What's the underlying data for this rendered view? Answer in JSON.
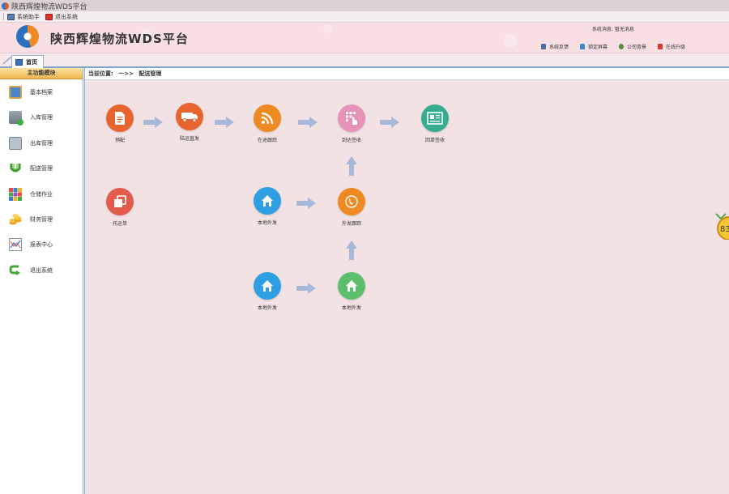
{
  "window": {
    "title": "陕西辉煌物流WDS平台"
  },
  "menubar": {
    "items": [
      {
        "label": "系统助手",
        "icon": "helper-icon"
      },
      {
        "label": "退出系统",
        "icon": "exit-icon"
      }
    ]
  },
  "header": {
    "brand_prefix": "陕西辉煌物流",
    "brand_wds": "WDS",
    "brand_suffix": "平台",
    "system_message": "系统消息: 暂无消息",
    "actions": [
      {
        "label": "系统反馈",
        "icon": "feedback-icon"
      },
      {
        "label": "锁定屏幕",
        "icon": "lock-icon"
      },
      {
        "label": "公司背景",
        "icon": "background-icon"
      },
      {
        "label": "在线升级",
        "icon": "upgrade-icon"
      }
    ]
  },
  "tabs": [
    {
      "label": "首页"
    }
  ],
  "sidebar": {
    "title": "主功能模块",
    "items": [
      {
        "label": "基本档案",
        "icon": "archive-icon"
      },
      {
        "label": "入库管理",
        "icon": "inbound-icon"
      },
      {
        "label": "出库管理",
        "icon": "outbound-icon"
      },
      {
        "label": "配送管理",
        "icon": "delivery-icon"
      },
      {
        "label": "仓储作业",
        "icon": "warehouse-icon"
      },
      {
        "label": "财务管理",
        "icon": "finance-icon"
      },
      {
        "label": "报表中心",
        "icon": "report-icon"
      },
      {
        "label": "退出系统",
        "icon": "logout-icon"
      }
    ]
  },
  "breadcrumb": {
    "prefix": "当前位置:",
    "arrow": "一>>",
    "current": "配送管理"
  },
  "flow": {
    "nodes": [
      {
        "label": "预配",
        "color": "#e8642f",
        "icon": "document-icon"
      },
      {
        "label": "陆运直发",
        "color": "#e8642f",
        "icon": "truck-icon"
      },
      {
        "label": "在途跟踪",
        "color": "#ef8a22",
        "icon": "rss-icon"
      },
      {
        "label": "到达签收",
        "color": "#e693b8",
        "icon": "touch-keypad-icon"
      },
      {
        "label": "回单签收",
        "color": "#35ad8e",
        "icon": "receipt-icon"
      },
      {
        "label": "托运单",
        "color": "#e35b4c",
        "icon": "copy-icon"
      },
      {
        "label": "本地外发",
        "color": "#2d9fe2",
        "icon": "home-icon"
      },
      {
        "label": "外发跟踪",
        "color": "#ef8a22",
        "icon": "phone-icon"
      },
      {
        "label": "本地外发",
        "color": "#2d9fe2",
        "icon": "home-icon"
      },
      {
        "label": "本地外发",
        "color": "#5cbf6d",
        "icon": "home-icon"
      }
    ]
  },
  "colors": {
    "arrow": "#a7b8d8",
    "sidebar_header": "#f3b651",
    "accent": "#3a70bd"
  },
  "edge_badge": {
    "text": "83"
  }
}
